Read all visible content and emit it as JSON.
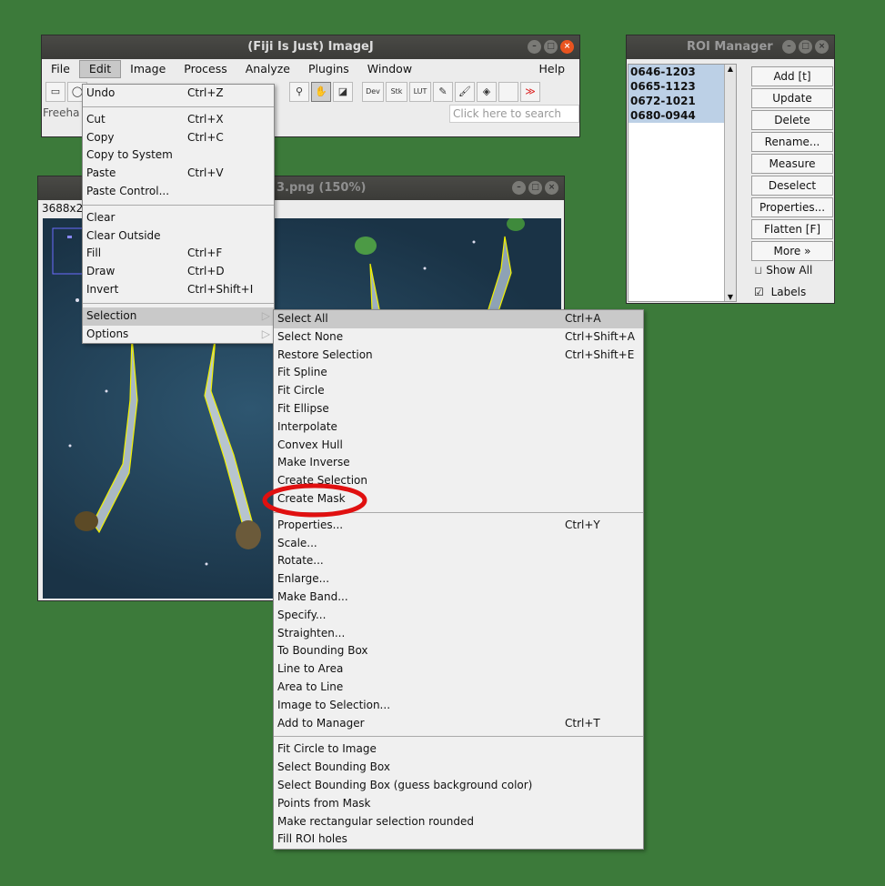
{
  "imagej": {
    "title": "(Fiji Is Just) ImageJ",
    "menus": [
      "File",
      "Edit",
      "Image",
      "Process",
      "Analyze",
      "Plugins",
      "Window",
      "Help"
    ],
    "active_menu": "Edit",
    "status_text": "Freeha",
    "search_placeholder": "Click here to search",
    "tools": {
      "dev": "Dev",
      "stk": "Stk",
      "lut": "LUT",
      "more": "≫"
    }
  },
  "image_window": {
    "title": "3.png (150%)",
    "info": "3688x2"
  },
  "edit_menu": {
    "items": [
      {
        "label": "Undo",
        "shortcut": "Ctrl+Z"
      },
      {
        "sep": true
      },
      {
        "label": "Cut",
        "shortcut": "Ctrl+X"
      },
      {
        "label": "Copy",
        "shortcut": "Ctrl+C"
      },
      {
        "label": "Copy to System",
        "shortcut": ""
      },
      {
        "label": "Paste",
        "shortcut": "Ctrl+V"
      },
      {
        "label": "Paste Control...",
        "shortcut": ""
      },
      {
        "sep": true
      },
      {
        "label": "Clear",
        "shortcut": ""
      },
      {
        "label": "Clear Outside",
        "shortcut": ""
      },
      {
        "label": "Fill",
        "shortcut": "Ctrl+F"
      },
      {
        "label": "Draw",
        "shortcut": "Ctrl+D"
      },
      {
        "label": "Invert",
        "shortcut": "Ctrl+Shift+I"
      },
      {
        "sep": true
      },
      {
        "label": "Selection",
        "shortcut": "",
        "submenu": true,
        "highlight": true
      },
      {
        "label": "Options",
        "shortcut": "",
        "submenu": true
      }
    ]
  },
  "selection_menu": {
    "items": [
      {
        "label": "Select All",
        "shortcut": "Ctrl+A",
        "highlight": true
      },
      {
        "label": "Select None",
        "shortcut": "Ctrl+Shift+A"
      },
      {
        "label": "Restore Selection",
        "shortcut": "Ctrl+Shift+E"
      },
      {
        "label": "Fit Spline",
        "shortcut": ""
      },
      {
        "label": "Fit Circle",
        "shortcut": ""
      },
      {
        "label": "Fit Ellipse",
        "shortcut": ""
      },
      {
        "label": "Interpolate",
        "shortcut": ""
      },
      {
        "label": "Convex Hull",
        "shortcut": ""
      },
      {
        "label": "Make Inverse",
        "shortcut": ""
      },
      {
        "label": "Create Selection",
        "shortcut": ""
      },
      {
        "label": "Create Mask",
        "shortcut": "",
        "circled": true
      },
      {
        "sep": true
      },
      {
        "label": "Properties...",
        "shortcut": "Ctrl+Y"
      },
      {
        "label": "Scale...",
        "shortcut": ""
      },
      {
        "label": "Rotate...",
        "shortcut": ""
      },
      {
        "label": "Enlarge...",
        "shortcut": ""
      },
      {
        "label": "Make Band...",
        "shortcut": ""
      },
      {
        "label": "Specify...",
        "shortcut": ""
      },
      {
        "label": "Straighten...",
        "shortcut": ""
      },
      {
        "label": "To Bounding Box",
        "shortcut": ""
      },
      {
        "label": "Line to Area",
        "shortcut": ""
      },
      {
        "label": "Area to Line",
        "shortcut": ""
      },
      {
        "label": "Image to Selection...",
        "shortcut": ""
      },
      {
        "label": "Add to Manager",
        "shortcut": "Ctrl+T"
      },
      {
        "sep": true
      },
      {
        "label": "Fit Circle to Image",
        "shortcut": ""
      },
      {
        "label": "Select Bounding Box",
        "shortcut": ""
      },
      {
        "label": "Select Bounding Box (guess background color)",
        "shortcut": ""
      },
      {
        "label": "Points from Mask",
        "shortcut": ""
      },
      {
        "label": "Make rectangular selection rounded",
        "shortcut": ""
      },
      {
        "label": "Fill ROI holes",
        "shortcut": ""
      }
    ]
  },
  "roi_manager": {
    "title": "ROI Manager",
    "rois": [
      "0646-1203",
      "0665-1123",
      "0672-1021",
      "0680-0944"
    ],
    "buttons": [
      "Add [t]",
      "Update",
      "Delete",
      "Rename...",
      "Measure",
      "Deselect",
      "Properties...",
      "Flatten [F]",
      "More »"
    ],
    "show_all": "Show All",
    "labels": "Labels"
  },
  "colors": {
    "desktop": "#3c7a3a",
    "highlight_circle": "#e01010",
    "roi_outline": "#f2f200"
  }
}
